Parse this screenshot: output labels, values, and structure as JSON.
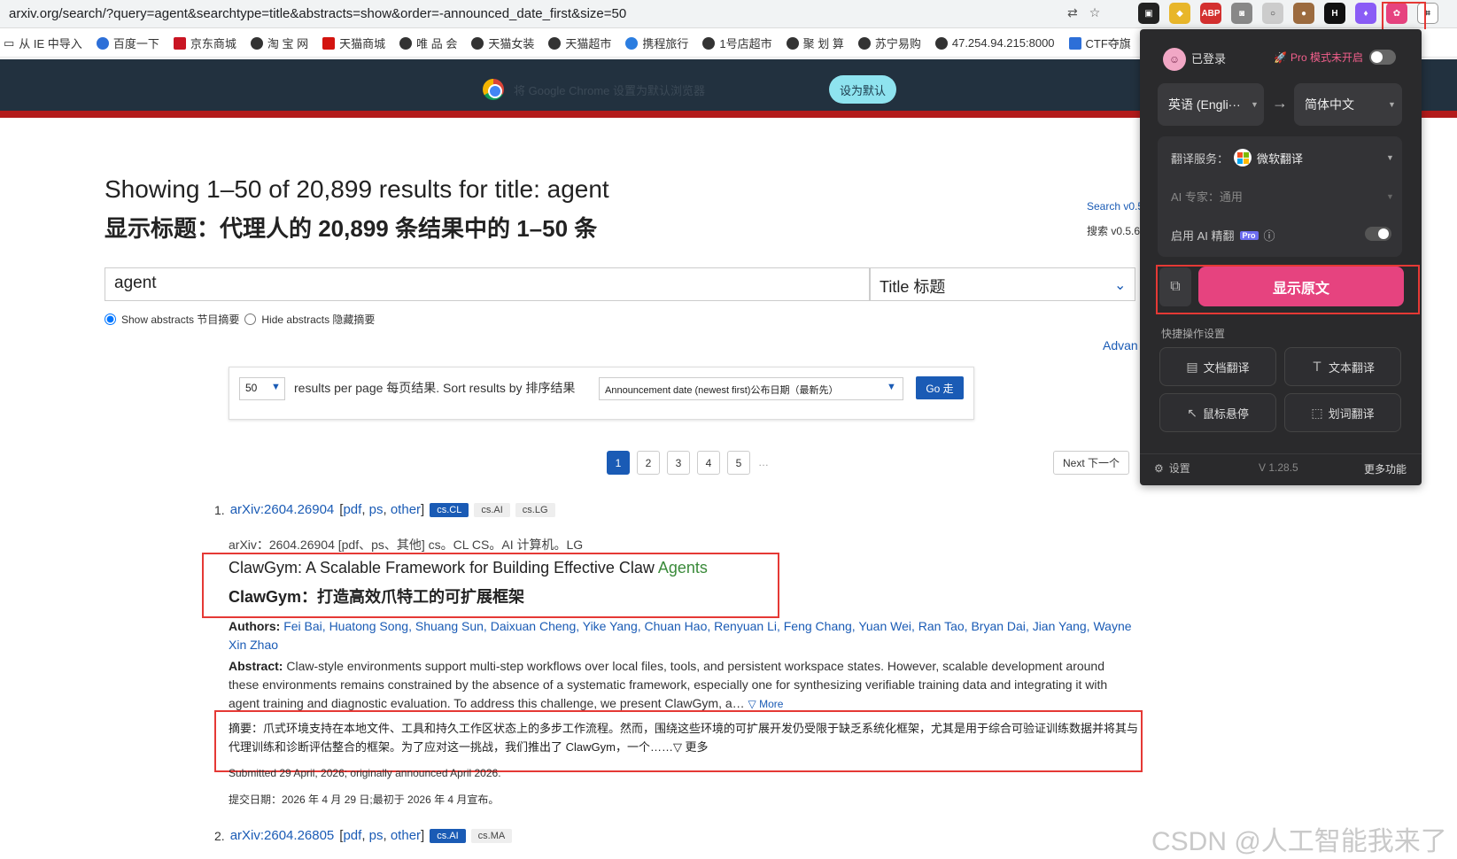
{
  "browser": {
    "url": "arxiv.org/search/?query=agent&searchtype=title&abstracts=show&order=-announced_date_first&size=50",
    "bookmarks": [
      "从 IE 中导入",
      "百度一下",
      "京东商城",
      "淘 宝 网",
      "天猫商城",
      "唯 品 会",
      "天猫女装",
      "天猫超市",
      "携程旅行",
      "1号店超市",
      "聚 划 算",
      "苏宁易购",
      "47.254.94.215:8000",
      "CTF夺旗"
    ],
    "banner_text": "将 Google Chrome 设置为默认浏览器",
    "set_default_label": "设为默认"
  },
  "page": {
    "heading": "Showing 1–50 of 20,899 results for title: agent",
    "heading_cn": "显示标题：代理人的 20,899 条结果中的 1–50 条",
    "search_version": "Search v0.5",
    "search_version_cn": "搜索 v0.5.6",
    "search_value": "agent",
    "field_value": "Title  标题",
    "show_abstracts": "Show abstracts  节目摘要",
    "hide_abstracts": "Hide abstracts  隐藏摘要",
    "advanced": "Advan",
    "per_page_value": "50",
    "rpp_label": "results per page  每页结果.  Sort results by  排序结果",
    "sort_value": "Announcement date (newest first)公布日期（最新先）",
    "go_label": "Go  走",
    "pages": [
      "1",
      "2",
      "3",
      "4",
      "5"
    ],
    "ellipsis": "…",
    "next_label": "Next  下一个"
  },
  "results": [
    {
      "num": "1.",
      "id": "arXiv:2604.26904",
      "links": [
        "pdf",
        "ps",
        "other"
      ],
      "tags": [
        "cs.CL",
        "cs.AI",
        "cs.LG"
      ],
      "id_cn": "arXiv：2604.26904 [pdf、ps、其他] cs。CL CS。AI 计算机。LG",
      "title_prefix": "ClawGym: A Scalable Framework for Building Effective Claw ",
      "title_keyword": "Agents",
      "title_cn": "ClawGym：打造高效爪特工的可扩展框架",
      "authors_label": "Authors:",
      "authors": "Fei Bai, Huatong Song, Shuang Sun, Daixuan Cheng, Yike Yang, Chuan Hao, Renyuan Li, Feng Chang, Yuan Wei, Ran Tao, Bryan Dai, Jian Yang, Wayne Xin Zhao",
      "abstract_label": "Abstract:",
      "abstract": "Claw-style environments support multi-step workflows over local files, tools, and persistent workspace states. However, scalable development around these environments remains constrained by the absence of a systematic framework, especially one for synthesizing verifiable training data and integrating it with agent training and diagnostic evaluation. To address this challenge, we present ClawGym, a…",
      "more_label": "▽ More",
      "abstract_cn": "摘要：爪式环境支持在本地文件、工具和持久工作区状态上的多步工作流程。然而，围绕这些环境的可扩展开发仍受限于缺乏系统化框架，尤其是用于综合可验证训练数据并将其与代理训练和诊断评估整合的框架。为了应对这一挑战，我们推出了 ClawGym，一个……▽ 更多",
      "submitted": "Submitted 29 April, 2026; originally announced April 2026.",
      "submitted_cn": "提交日期：2026 年 4 月 29 日;最初于 2026 年 4 月宣布。"
    },
    {
      "num": "2.",
      "id": "arXiv:2604.26805",
      "links": [
        "pdf",
        "ps",
        "other"
      ],
      "tags": [
        "cs.AI",
        "cs.MA"
      ]
    }
  ],
  "popup": {
    "login": "已登录",
    "pro_mode": "Pro 模式未开启",
    "source_lang": "英语 (Engli···",
    "target_lang": "简体中文",
    "service_label": "翻译服务：",
    "service_value": "微软翻译",
    "ai_expert": "AI 专家：通用",
    "ai_refine": "启用 AI 精翻",
    "pro_badge": "Pro",
    "show_original": "显示原文",
    "quick_title": "快捷操作设置",
    "quick": [
      "文档翻译",
      "文本翻译",
      "鼠标悬停",
      "划词翻译"
    ],
    "settings": "设置",
    "version": "V 1.28.5",
    "more": "更多功能"
  },
  "watermark": "CSDN @人工智能我来了",
  "colors": {
    "accent": "#1a5bb5",
    "popup_accent": "#e6437f",
    "arxiv_red": "#b31b1b",
    "highlight_box": "#e53935"
  }
}
